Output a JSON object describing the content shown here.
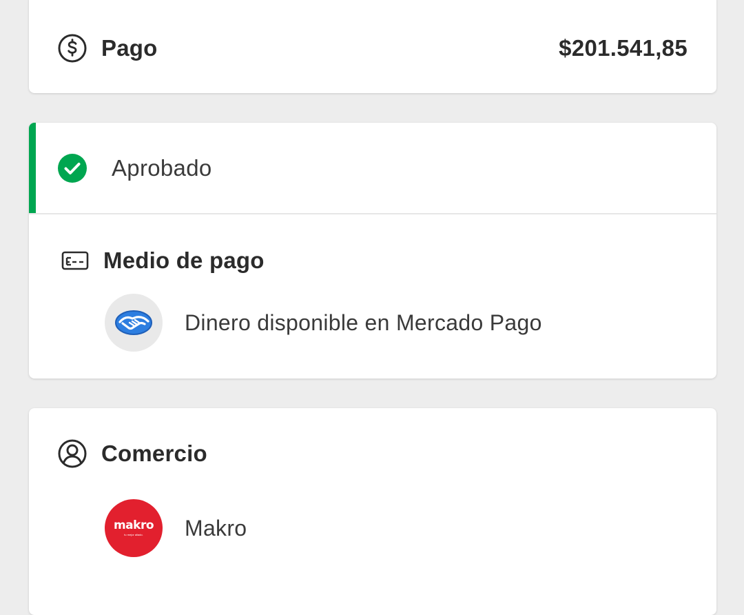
{
  "colors": {
    "page_background": "#ededed",
    "card_background": "#ffffff",
    "approved_green": "#00a650",
    "makro_red": "#e2202e",
    "mp_blue": "#2d7ee0",
    "text_primary": "#2b2b2b"
  },
  "payment": {
    "label": "Pago",
    "amount": "$201.541,85",
    "icon": "dollar-circle-icon"
  },
  "status": {
    "label": "Aprobado",
    "icon": "check-circle-icon"
  },
  "payment_method": {
    "title": "Medio de pago",
    "icon": "credit-card-icon",
    "method_name": "Dinero disponible en Mercado Pago",
    "method_logo": "mercado-pago-handshake-logo"
  },
  "merchant": {
    "title": "Comercio",
    "icon": "user-circle-icon",
    "name": "Makro",
    "logo_text": "makro",
    "logo_tagline": "tu mejor aliado."
  }
}
